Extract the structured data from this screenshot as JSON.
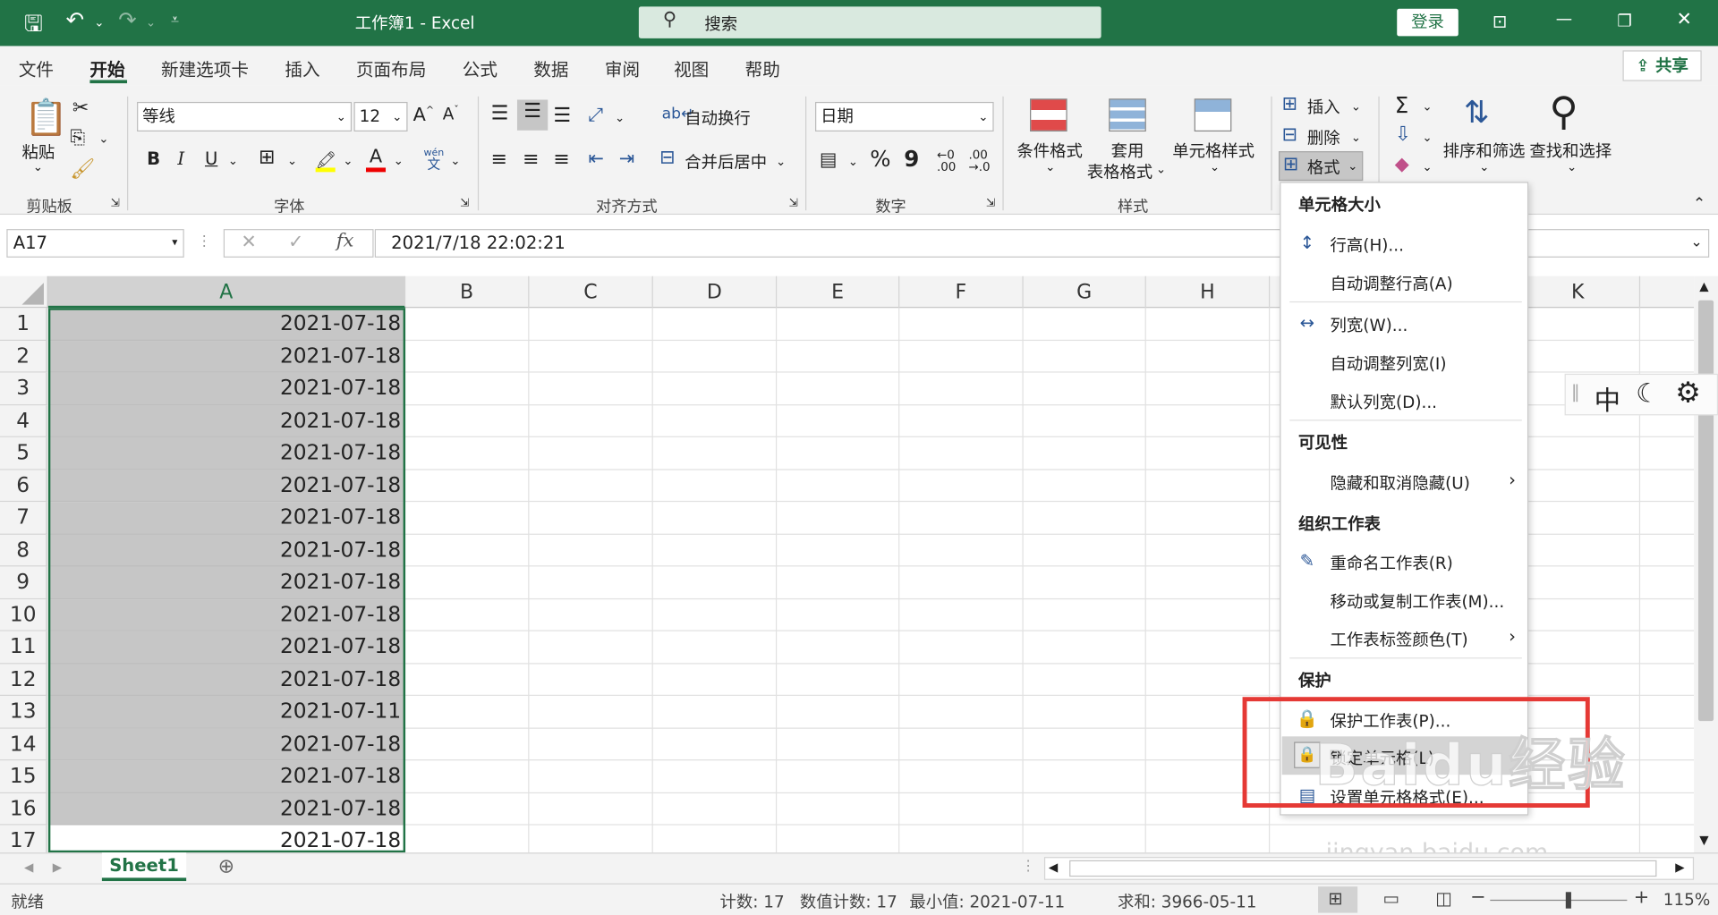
{
  "title_bar": {
    "app_title": "工作簿1  -  Excel",
    "search_placeholder": "搜索",
    "login_label": "登录"
  },
  "tabs": [
    "文件",
    "开始",
    "新建选项卡",
    "插入",
    "页面布局",
    "公式",
    "数据",
    "审阅",
    "视图",
    "帮助"
  ],
  "share_label": "共享",
  "ribbon": {
    "clipboard": {
      "paste": "粘贴",
      "group": "剪贴板"
    },
    "font": {
      "name": "等线",
      "size": "12",
      "bold": "B",
      "italic": "I",
      "underline": "U",
      "group": "字体",
      "wen": "wén",
      "wen2": "文"
    },
    "alignment": {
      "wrap": "自动换行",
      "merge": "合并后居中",
      "group": "对齐方式"
    },
    "number": {
      "format": "日期",
      "percent": "%",
      "comma": "9",
      "group": "数字"
    },
    "styles": {
      "conditional": "条件格式",
      "table_l1": "套用",
      "table_l2": "表格格式",
      "cell_styles": "单元格样式",
      "group": "样式"
    },
    "cells": {
      "insert": "插入",
      "delete": "删除",
      "format": "格式"
    },
    "editing": {
      "sort": "排序和筛选",
      "find": "查找和选择"
    }
  },
  "name_box": "A17",
  "formula": "2021/7/18  22:02:21",
  "columns": [
    "A",
    "B",
    "C",
    "D",
    "E",
    "F",
    "G",
    "H",
    "K"
  ],
  "rows": [
    {
      "n": "1",
      "a": "2021-07-18"
    },
    {
      "n": "2",
      "a": "2021-07-18"
    },
    {
      "n": "3",
      "a": "2021-07-18"
    },
    {
      "n": "4",
      "a": "2021-07-18"
    },
    {
      "n": "5",
      "a": "2021-07-18"
    },
    {
      "n": "6",
      "a": "2021-07-18"
    },
    {
      "n": "7",
      "a": "2021-07-18"
    },
    {
      "n": "8",
      "a": "2021-07-18"
    },
    {
      "n": "9",
      "a": "2021-07-18"
    },
    {
      "n": "10",
      "a": "2021-07-18"
    },
    {
      "n": "11",
      "a": "2021-07-18"
    },
    {
      "n": "12",
      "a": "2021-07-18"
    },
    {
      "n": "13",
      "a": "2021-07-11"
    },
    {
      "n": "14",
      "a": "2021-07-18"
    },
    {
      "n": "15",
      "a": "2021-07-18"
    },
    {
      "n": "16",
      "a": "2021-07-18"
    },
    {
      "n": "17",
      "a": "2021-07-18"
    }
  ],
  "format_menu": {
    "h_size": "单元格大小",
    "row_height": "行高(H)...",
    "autofit_row": "自动调整行高(A)",
    "col_width": "列宽(W)...",
    "autofit_col": "自动调整列宽(I)",
    "default_width": "默认列宽(D)...",
    "h_visibility": "可见性",
    "hide_unhide": "隐藏和取消隐藏(U)",
    "h_organize": "组织工作表",
    "rename": "重命名工作表(R)",
    "move_copy": "移动或复制工作表(M)...",
    "tab_color": "工作表标签颜色(T)",
    "h_protect": "保护",
    "protect_sheet": "保护工作表(P)...",
    "lock_cell": "锁定单元格(L)",
    "format_cells": "设置单元格格式(E)..."
  },
  "ime_bar": {
    "mode": "中"
  },
  "sheet_tab": "Sheet1",
  "status": {
    "ready": "就绪",
    "count": "计数: 17",
    "num_count": "数值计数: 17",
    "min": "最小值: 2021-07-11",
    "sum": "求和: 3966-05-11",
    "zoom": "115%"
  },
  "watermark": {
    "text": "Baidu经验",
    "url": "jingyan.baidu.com"
  },
  "colors": {
    "excel_green": "#217346",
    "highlight_red": "#e53935",
    "selection_gray": "#c6c6c6"
  }
}
